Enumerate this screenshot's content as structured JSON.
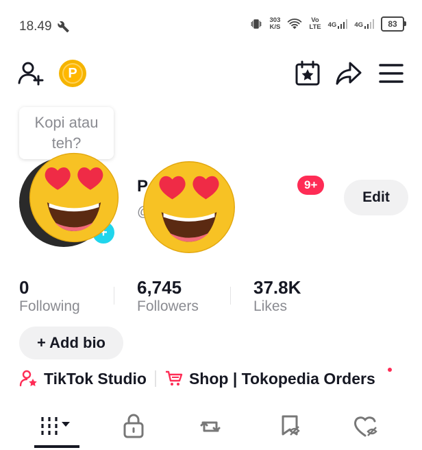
{
  "status_bar": {
    "time": "18.49",
    "net_speed_value": "303",
    "net_speed_unit": "K/S",
    "volte_top": "Vo",
    "volte_bottom": "LTE",
    "sig1": "4G",
    "sig2": "4G",
    "battery": "83"
  },
  "profile": {
    "coin_letter": "P",
    "tooltip": "Kopi atau teh?",
    "name": "P        PE IB...",
    "handle_symbol": "@",
    "notifications": "9+",
    "edit_label": "Edit",
    "stats": [
      {
        "value": "0",
        "label": "Following"
      },
      {
        "value": "6,745",
        "label": "Followers"
      },
      {
        "value": "37.8K",
        "label": "Likes"
      }
    ],
    "add_bio": "+ Add bio",
    "studio_label": "TikTok Studio",
    "shop_label": "Shop | Tokopedia Orders"
  },
  "colors": {
    "accent": "#fe2c55",
    "coin": "#ffb700",
    "badge": "#20d5ec"
  },
  "icons": {
    "add_friend": "person-plus-icon",
    "coin": "coin-icon",
    "calendar": "calendar-star-icon",
    "share": "share-arrow-icon",
    "menu": "hamburger-menu-icon"
  },
  "tabs": [
    {
      "name": "videos-grid"
    },
    {
      "name": "private"
    },
    {
      "name": "reposts"
    },
    {
      "name": "favorites"
    },
    {
      "name": "liked"
    }
  ]
}
